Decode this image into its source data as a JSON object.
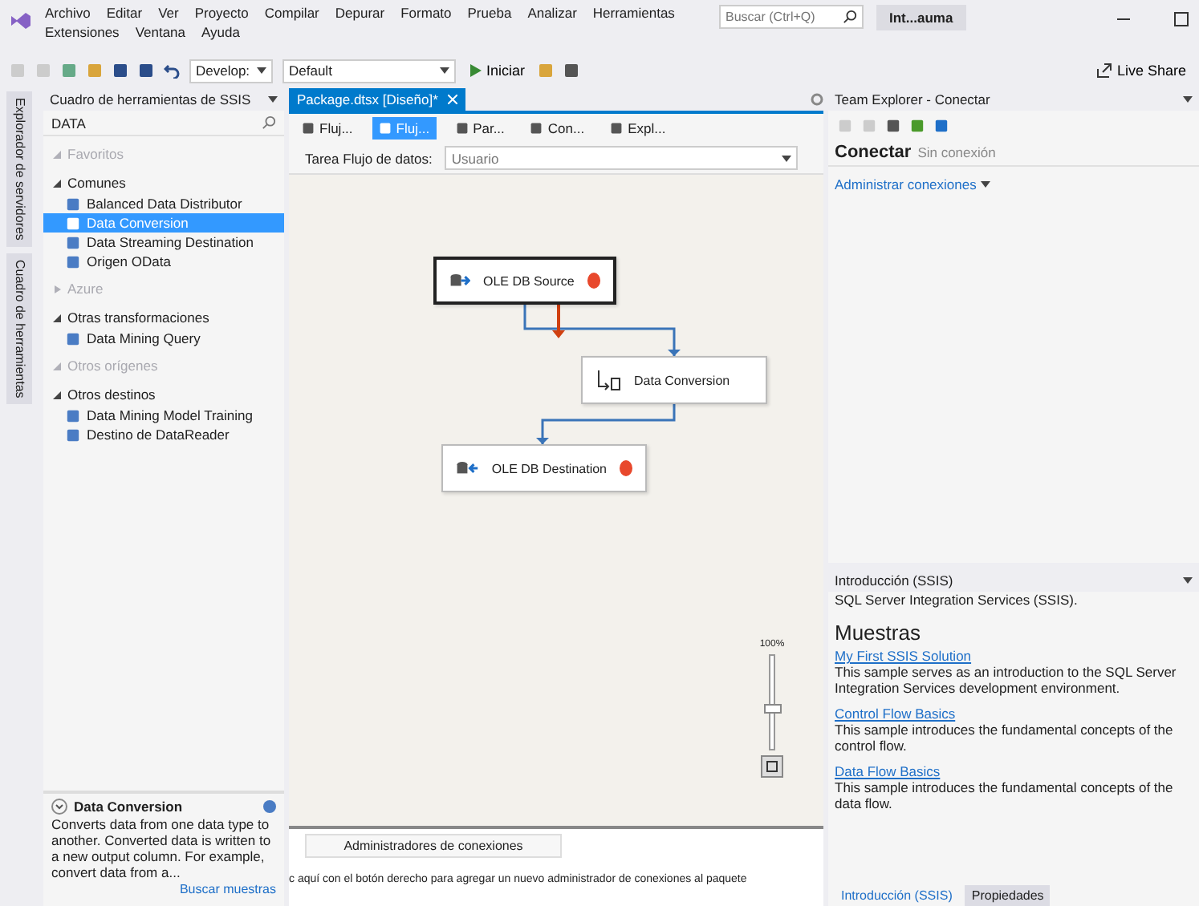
{
  "menu": {
    "row1": [
      "Archivo",
      "Editar",
      "Ver",
      "Proyecto",
      "Compilar",
      "Depurar",
      "Formato",
      "Prueba",
      "Analizar",
      "Herramientas"
    ],
    "row2": [
      "Extensiones",
      "Ventana",
      "Ayuda"
    ]
  },
  "search": {
    "placeholder": "Buscar (Ctrl+Q)"
  },
  "account": "Int...auma",
  "toolbar": {
    "config": "Develop:",
    "platform": "Default",
    "start": "Iniciar",
    "live_share": "Live Share"
  },
  "side_tabs": [
    "Explorador de servidores",
    "Cuadro de herramientas"
  ],
  "toolbox": {
    "title": "Cuadro de herramientas de SSIS",
    "search_value": "DATA",
    "groups": [
      {
        "label": "Favoritos",
        "expanded": true,
        "disabled": true
      },
      {
        "label": "Comunes",
        "expanded": true,
        "disabled": false,
        "children": [
          {
            "label": "Balanced Data Distributor",
            "selected": false
          },
          {
            "label": "Data Conversion",
            "selected": true
          },
          {
            "label": "Data Streaming Destination",
            "selected": false
          },
          {
            "label": "Origen OData",
            "selected": false
          }
        ]
      },
      {
        "label": "Azure",
        "expanded": false,
        "disabled": true
      },
      {
        "label": "Otras transformaciones",
        "expanded": true,
        "disabled": false,
        "children": [
          {
            "label": "Data Mining Query",
            "selected": false
          }
        ]
      },
      {
        "label": "Otros orígenes",
        "expanded": true,
        "disabled": true
      },
      {
        "label": "Otros destinos",
        "expanded": true,
        "disabled": false,
        "children": [
          {
            "label": "Data Mining Model Training",
            "selected": false
          },
          {
            "label": "Destino de DataReader",
            "selected": false
          }
        ]
      }
    ],
    "info": {
      "title": "Data Conversion",
      "text": "Converts data from one data type to another. Converted data is written to a new output column. For example, convert data from a...",
      "link": "Buscar muestras"
    }
  },
  "document": {
    "tab": "Package.dtsx [Diseño]*",
    "designer_tabs": [
      {
        "label": "Fluj...",
        "selected": false
      },
      {
        "label": "Fluj...",
        "selected": true
      },
      {
        "label": "Par...",
        "selected": false
      },
      {
        "label": "Con...",
        "selected": false
      },
      {
        "label": "Expl...",
        "selected": false
      }
    ],
    "task_label": "Tarea Flujo de datos:",
    "task_value": "Usuario",
    "nodes": [
      {
        "label": "OLE DB Source",
        "kind": "source",
        "error": true,
        "selected": true
      },
      {
        "label": "Data Conversion",
        "kind": "transform",
        "error": false,
        "selected": false
      },
      {
        "label": "OLE DB Destination",
        "kind": "destination",
        "error": true,
        "selected": false
      }
    ],
    "zoom": {
      "label": "100%",
      "level": 0.45
    },
    "connections_tab": "Administradores de conexiones",
    "connections_hint": "c aquí con el botón derecho para agregar un nuevo administrador de conexiones al paquete"
  },
  "team_explorer": {
    "title": "Team Explorer - Conectar",
    "heading": "Conectar",
    "status": "Sin conexión",
    "link": "Administrar conexiones"
  },
  "intro": {
    "title": "Introducción (SSIS)",
    "subtitle": "SQL Server Integration Services (SSIS).",
    "heading": "Muestras",
    "samples": [
      {
        "link": "My First SSIS Solution",
        "text": "This sample serves as an introduction to the SQL Server Integration Services development environment."
      },
      {
        "link": "Control Flow Basics",
        "text": "This sample introduces the fundamental concepts of the control flow."
      },
      {
        "link": "Data Flow Basics",
        "text": "This sample introduces the fundamental concepts of the data flow."
      }
    ],
    "bottom_tabs": [
      {
        "label": "Introducción (SSIS)",
        "selected": true
      },
      {
        "label": "Propiedades",
        "selected": false
      }
    ]
  }
}
